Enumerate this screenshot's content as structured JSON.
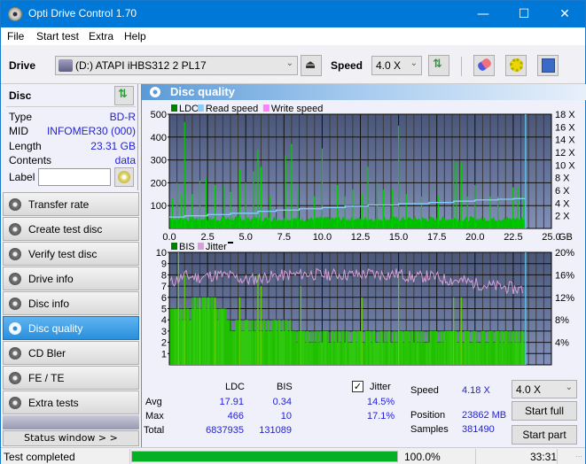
{
  "window": {
    "title": "Opti Drive Control 1.70",
    "minimize": "—",
    "maximize": "☐",
    "close": "✕"
  },
  "menu": [
    "File",
    "Start test",
    "Extra",
    "Help"
  ],
  "toolbar": {
    "drive_label": "Drive",
    "drive_value": "(D:)  ATAPI iHBS312  2 PL17",
    "speed_label": "Speed",
    "speed_value": "4.0 X"
  },
  "disc": {
    "header": "Disc",
    "rows": [
      {
        "key": "Type",
        "value": "BD-R"
      },
      {
        "key": "MID",
        "value": "INFOMER30 (000)"
      },
      {
        "key": "Length",
        "value": "23.31 GB"
      },
      {
        "key": "Contents",
        "value": "data"
      }
    ],
    "label_key": "Label",
    "label_value": ""
  },
  "nav": [
    {
      "label": "Transfer rate",
      "active": false
    },
    {
      "label": "Create test disc",
      "active": false
    },
    {
      "label": "Verify test disc",
      "active": false
    },
    {
      "label": "Drive info",
      "active": false
    },
    {
      "label": "Disc info",
      "active": false
    },
    {
      "label": "Disc quality",
      "active": true
    },
    {
      "label": "CD Bler",
      "active": false
    },
    {
      "label": "FE / TE",
      "active": false
    },
    {
      "label": "Extra tests",
      "active": false
    }
  ],
  "status_window_label": "Status window > >",
  "panel_title": "Disc quality",
  "chart_data": [
    {
      "type": "bar",
      "title": "LDC",
      "legend": [
        "LDC",
        "Read speed",
        "Write speed"
      ],
      "legend_colors": [
        "#008000",
        "#87cefa",
        "#ff80ff"
      ],
      "xlabel": "GB",
      "xlim": [
        0,
        25
      ],
      "x_ticks": [
        "0.0",
        "2.5",
        "5.0",
        "7.5",
        "10.0",
        "12.5",
        "15.0",
        "17.5",
        "20.0",
        "22.5",
        "25.0"
      ],
      "ylim": [
        0,
        500
      ],
      "y_ticks": [
        "100",
        "200",
        "300",
        "400",
        "500"
      ],
      "y2lim": [
        0,
        18
      ],
      "y2_ticks": [
        "2 X",
        "4 X",
        "6 X",
        "8 X",
        "10 X",
        "12 X",
        "14 X",
        "16 X",
        "18 X"
      ],
      "ldc_peaks": [
        [
          0.2,
          130
        ],
        [
          0.5,
          200
        ],
        [
          0.8,
          150
        ],
        [
          1.0,
          466
        ],
        [
          1.5,
          150
        ],
        [
          2.0,
          210
        ],
        [
          2.4,
          220
        ],
        [
          3.0,
          190
        ],
        [
          3.6,
          190
        ],
        [
          4.0,
          160
        ],
        [
          4.6,
          260
        ],
        [
          5.0,
          200
        ],
        [
          5.5,
          250
        ],
        [
          5.8,
          345
        ],
        [
          6.0,
          270
        ],
        [
          6.6,
          140
        ],
        [
          7.6,
          320
        ],
        [
          8.0,
          370
        ],
        [
          8.4,
          190
        ],
        [
          9.5,
          140
        ],
        [
          10.0,
          350
        ],
        [
          11.0,
          190
        ],
        [
          11.5,
          140
        ],
        [
          12.0,
          170
        ],
        [
          12.6,
          150
        ],
        [
          13.0,
          270
        ],
        [
          13.6,
          200
        ],
        [
          14.0,
          170
        ],
        [
          14.6,
          170
        ],
        [
          15.0,
          450
        ],
        [
          15.5,
          150
        ],
        [
          16.5,
          140
        ],
        [
          17.6,
          140
        ],
        [
          18.6,
          300
        ],
        [
          18.8,
          290
        ],
        [
          19.1,
          290
        ],
        [
          19.5,
          140
        ],
        [
          20.0,
          190
        ],
        [
          21.0,
          140
        ],
        [
          21.5,
          140
        ],
        [
          22.5,
          180
        ],
        [
          22.8,
          180
        ],
        [
          23.2,
          140
        ]
      ],
      "ldc_baseline": 40,
      "read_speed": [
        [
          0,
          1.8
        ],
        [
          1,
          2.0
        ],
        [
          2.5,
          2.2
        ],
        [
          4,
          2.4
        ],
        [
          5.8,
          2.7
        ],
        [
          7,
          2.9
        ],
        [
          8.5,
          3.1
        ],
        [
          10,
          3.3
        ],
        [
          11.5,
          3.5
        ],
        [
          13,
          3.7
        ],
        [
          15,
          3.9
        ],
        [
          17,
          4.1
        ],
        [
          18.6,
          4.3
        ],
        [
          20,
          4.5
        ],
        [
          21.5,
          4.6
        ],
        [
          22.5,
          4.7
        ],
        [
          23.3,
          4.7
        ]
      ],
      "end_marker": 23.31
    },
    {
      "type": "bar",
      "title": "BIS",
      "legend": [
        "BIS",
        "Jitter"
      ],
      "legend_colors": [
        "#008000",
        "#d8a0d8"
      ],
      "xlabel": "GB",
      "xlim": [
        0,
        25
      ],
      "x_ticks": [
        "0.0",
        "2.5",
        "5.0",
        "7.5",
        "10.0",
        "12.5",
        "15.0",
        "17.5",
        "20.0",
        "22.5",
        "25.0"
      ],
      "ylim": [
        0,
        10
      ],
      "y_ticks": [
        "1",
        "2",
        "3",
        "4",
        "5",
        "6",
        "7",
        "8",
        "9",
        "10"
      ],
      "y2lim": [
        0,
        20
      ],
      "y2_ticks": [
        "4%",
        "8%",
        "12%",
        "16%",
        "20%"
      ],
      "bis_levels": [
        [
          0,
          5
        ],
        [
          1.5,
          6
        ],
        [
          3,
          5
        ],
        [
          4,
          4
        ],
        [
          8,
          3
        ],
        [
          12,
          3
        ],
        [
          23.3,
          0
        ]
      ],
      "bis_peaks": [
        [
          0.6,
          10
        ],
        [
          1.0,
          8
        ],
        [
          2.0,
          6
        ],
        [
          3.0,
          6
        ],
        [
          4.6,
          6
        ],
        [
          5.8,
          8
        ],
        [
          6.0,
          7
        ],
        [
          8.6,
          7
        ],
        [
          12.6,
          6
        ],
        [
          15.0,
          8
        ],
        [
          18.6,
          6
        ],
        [
          19.1,
          6
        ]
      ],
      "jitter": [
        [
          0,
          14.5
        ],
        [
          1,
          15.8
        ],
        [
          2,
          15.5
        ],
        [
          3,
          16.0
        ],
        [
          4,
          15.8
        ],
        [
          5,
          15.0
        ],
        [
          6,
          15.5
        ],
        [
          7,
          15.8
        ],
        [
          8,
          16.0
        ],
        [
          9,
          16.2
        ],
        [
          10,
          16.0
        ],
        [
          11,
          16.1
        ],
        [
          12,
          16.0
        ],
        [
          13,
          16.2
        ],
        [
          14,
          16.0
        ],
        [
          15,
          16.2
        ],
        [
          16,
          15.5
        ],
        [
          17,
          15.8
        ],
        [
          18,
          15.2
        ],
        [
          19,
          15.0
        ],
        [
          20,
          14.5
        ],
        [
          21,
          14.0
        ],
        [
          22,
          13.8
        ],
        [
          23,
          13.4
        ]
      ],
      "end_marker": 23.31
    }
  ],
  "stats": {
    "col_ldc": "LDC",
    "col_bis": "BIS",
    "avg_label": "Avg",
    "max_label": "Max",
    "total_label": "Total",
    "ldc_avg": "17.91",
    "bis_avg": "0.34",
    "ldc_max": "466",
    "bis_max": "10",
    "ldc_total": "6837935",
    "bis_total": "131089",
    "jitter_label": "Jitter",
    "jitter_checked": true,
    "jitter_avg": "14.5%",
    "jitter_max": "17.1%",
    "speed_label": "Speed",
    "speed_value": "4.18 X",
    "position_label": "Position",
    "position_value": "23862 MB",
    "samples_label": "Samples",
    "samples_value": "381490",
    "speed_select": "4.0 X",
    "start_full": "Start full",
    "start_part": "Start part"
  },
  "statusbar": {
    "text": "Test completed",
    "progress": 100.0,
    "progress_text": "100.0%",
    "time": "33:31"
  }
}
